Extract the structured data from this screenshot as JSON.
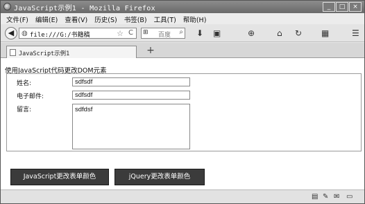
{
  "window": {
    "title": "JavaScript示例1 - Mozilla Firefox",
    "controls": [
      "_",
      "□",
      "×"
    ]
  },
  "menu": [
    "文件(F)",
    "编辑(E)",
    "查看(V)",
    "历史(S)",
    "书签(B)",
    "工具(T)",
    "帮助(H)"
  ],
  "nav": {
    "back": "◀",
    "url": "file:///G:/书籍稿",
    "star": "☆",
    "reload": "C",
    "search_engine": "⊞",
    "search_placeholder": "百度",
    "search_icon": "⌕",
    "toolbar_icons": [
      "⬇",
      "▣",
      "⊕",
      "⌂",
      "↻",
      "▦",
      "☰"
    ]
  },
  "tabs": {
    "active_label": "JavaScript示例1",
    "new_tab": "+"
  },
  "page": {
    "heading": "使用JavaScript代码更改DOM元素",
    "name_label": "姓名:",
    "name_value": "sdfsdf",
    "email_label": "电子邮件:",
    "email_value": "sdfsdf",
    "message_label": "留言:",
    "message_value": "sdfdsf",
    "btn_js": "JavaScript更改表单颜色",
    "btn_jquery": "jQuery更改表单颜色"
  },
  "status": {
    "icons": [
      "▤",
      "✎",
      "✉",
      "▭"
    ]
  }
}
